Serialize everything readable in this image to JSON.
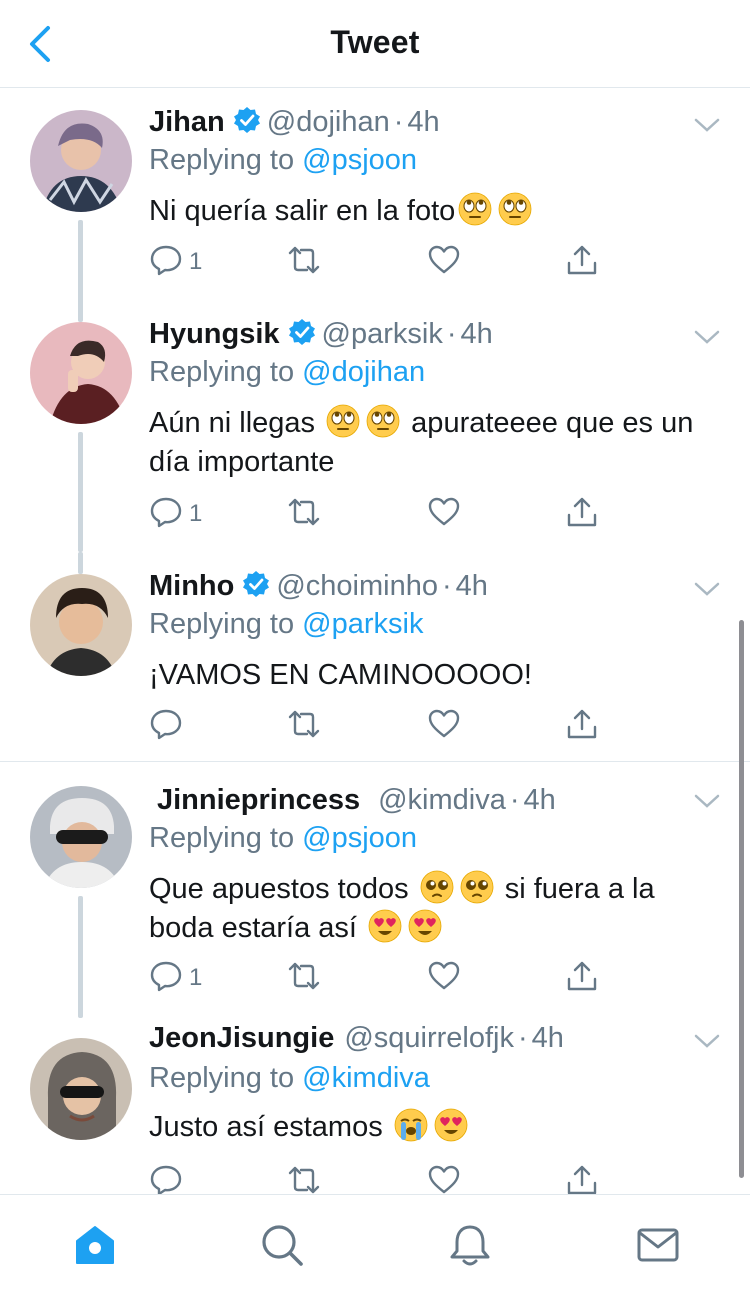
{
  "header": {
    "title": "Tweet",
    "back_icon": "chevron-left-icon"
  },
  "colors": {
    "accent": "#1da1f2",
    "secondary_text": "#657786",
    "divider": "#e1e8ed"
  },
  "tweets": [
    {
      "name": "Jihan",
      "verified": true,
      "handle": "@dojihan",
      "time": "4h",
      "replying_label": "Replying to",
      "replying_to": "@psjoon",
      "text_parts": [
        "Ni quería salir en la foto"
      ],
      "emojis": [
        "rolling-eyes",
        "rolling-eyes"
      ],
      "reply_count": "1"
    },
    {
      "name": "Hyungsik",
      "verified": true,
      "handle": "@parksik",
      "time": "4h",
      "replying_label": "Replying to",
      "replying_to": "@dojihan",
      "text_parts": [
        "Aún ni llegas ",
        " apurateeee que es un día importante"
      ],
      "emojis": [
        "rolling-eyes",
        "rolling-eyes"
      ],
      "reply_count": "1"
    },
    {
      "name": "Minho",
      "verified": true,
      "handle": "@choiminho",
      "time": "4h",
      "replying_label": "Replying to",
      "replying_to": "@parksik",
      "text_parts": [
        "¡VAMOS EN CAMINOOOOO!"
      ],
      "emojis": [],
      "reply_count": ""
    },
    {
      "name": "Jinnieprincess",
      "verified": false,
      "handle": "@kimdiva",
      "time": "4h",
      "replying_label": "Replying to",
      "replying_to": "@psjoon",
      "text_parts": [
        "Que apuestos todos ",
        " si fuera a la boda estaría así "
      ],
      "emojis": [
        "pleading-face",
        "pleading-face",
        "heart-eyes",
        "heart-eyes"
      ],
      "reply_count": "1"
    },
    {
      "name": "JeonJisungie",
      "verified": false,
      "handle": "@squirrelofjk",
      "time": "4h",
      "replying_label": "Replying to",
      "replying_to": "@kimdiva",
      "text_parts": [
        "Justo así estamos "
      ],
      "emojis": [
        "loudly-crying",
        "heart-eyes"
      ],
      "reply_count": ""
    }
  ],
  "tabbar": [
    "home-icon",
    "search-icon",
    "notifications-bell-icon",
    "messages-envelope-icon"
  ]
}
